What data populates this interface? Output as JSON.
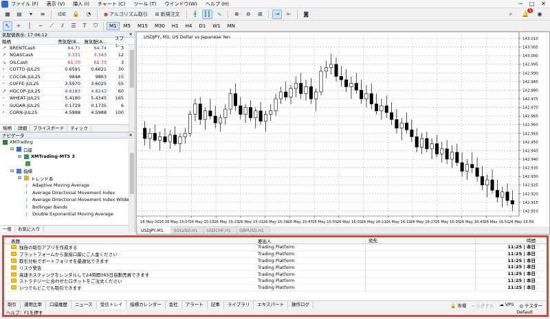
{
  "menu": {
    "items": [
      "ファイル (F)",
      "表示 (V)",
      "挿入 (I)",
      "チャート (C)",
      "ツール (T)",
      "ウインドウ(W)",
      "ヘルプ (H)"
    ]
  },
  "toolbar": {
    "ide_label": "IDE",
    "algo_label": "アルゴリズム取引",
    "new_order_label": "新規注文",
    "notif_count": "1"
  },
  "timeframes": [
    "M1",
    "M5",
    "M15",
    "M30",
    "H1",
    "H4",
    "D1",
    "W1",
    "MN"
  ],
  "market_watch": {
    "title": "気配値表示: 17:06:12",
    "columns": [
      "銘柄",
      "売気配(B...",
      "買気配(A...",
      "スプレ..."
    ],
    "rows": [
      {
        "dir": "up",
        "symbol": "BRENTCash",
        "bid": "64.71",
        "ask": "64.74",
        "spread": "3",
        "color": "blue"
      },
      {
        "dir": "up",
        "symbol": "NGASCash",
        "bid": "3.331",
        "ask": "3.343",
        "spread": "12",
        "color": "blue"
      },
      {
        "dir": "down",
        "symbol": "OILCash",
        "bid": "61.70",
        "ask": "61.73",
        "spread": "3",
        "color": "red"
      },
      {
        "dir": "none",
        "symbol": "COTTO-JUL25",
        "bid": "0.6591",
        "ask": "0.6621",
        "spread": "30",
        "color": "black"
      },
      {
        "dir": "none",
        "symbol": "COCOA-JUL25",
        "bid": "9848",
        "ask": "9863",
        "spread": "15",
        "color": "black"
      },
      {
        "dir": "none",
        "symbol": "COFFE-JUL25",
        "bid": "3.5970",
        "ask": "3.6025",
        "spread": "55",
        "color": "black"
      },
      {
        "dir": "up",
        "symbol": "HGCOP-JUL25",
        "bid": "4.8183",
        "ask": "4.8243",
        "spread": "60",
        "color": "blue"
      },
      {
        "dir": "none",
        "symbol": "WHEAT-JUL25",
        "bid": "5.4180",
        "ask": "5.4345",
        "spread": "165",
        "color": "black"
      },
      {
        "dir": "none",
        "symbol": "SUGAR-JUL25",
        "bid": "0.1729",
        "ask": "0.1735",
        "spread": "6",
        "color": "black"
      },
      {
        "dir": "none",
        "symbol": "CORN-JUL25",
        "bid": "4.5988",
        "ask": "4.5988",
        "spread": "100",
        "color": "black"
      }
    ],
    "tabs": [
      "銘柄",
      "詳細",
      "プライスボード",
      "ティック"
    ]
  },
  "navigator": {
    "title": "ナビゲータ",
    "items": [
      {
        "level": 0,
        "label": "XMTrading",
        "icon": "broker-icon"
      },
      {
        "level": 1,
        "label": "口座",
        "icon": "accounts-icon"
      },
      {
        "level": 2,
        "label": "XMTrading-MT5 3",
        "icon": "server-icon"
      },
      {
        "level": 3,
        "label": "",
        "icon": "user-icon"
      },
      {
        "level": 1,
        "label": "指標",
        "icon": "indicators-icon"
      },
      {
        "level": 2,
        "label": "トレンド系",
        "icon": "folder-icon"
      },
      {
        "level": 3,
        "label": "Adaptive Moving Average",
        "icon": "indicator-icon"
      },
      {
        "level": 3,
        "label": "Average Directional Movement Index",
        "icon": "indicator-icon"
      },
      {
        "level": 3,
        "label": "Average Directional Movement Index Wilder",
        "icon": "indicator-icon"
      },
      {
        "level": 3,
        "label": "Bollinger Bands",
        "icon": "indicator-icon"
      },
      {
        "level": 3,
        "label": "Double Exponential Moving Average",
        "icon": "indicator-icon"
      }
    ],
    "tabs": [
      "一般",
      "お気に入り"
    ]
  },
  "chart": {
    "title": "USDJPY, M1: US Dollar vs Japanese Yen",
    "tabs": [
      "USDJPY,M1",
      "SOLUSD,H1",
      "USDCHF,H1",
      "GBPUSD,H1"
    ],
    "colors": {
      "up": "#ffffff",
      "down": "#000000",
      "grid": "#b0b0b0"
    }
  },
  "chart_data": {
    "type": "candlestick",
    "y_ticks": [
      "143.010",
      "143.005",
      "143.000",
      "142.995",
      "142.990",
      "142.985",
      "142.980",
      "142.975",
      "142.970",
      "142.965",
      "142.960",
      "142.955",
      "142.950",
      "142.945",
      "142.940",
      "142.935",
      "142.930",
      "142.925",
      "142.920",
      "142.915",
      "142.910"
    ],
    "ylim": [
      142.907,
      143.012
    ],
    "x_ticks": [
      "26 May 2025",
      "26 May 15:07",
      "26 May 15:15",
      "26 May 15:23",
      "26 May 15:31",
      "26 May 15:39",
      "26 May 15:47",
      "26 May 15:55",
      "26 May 16:03",
      "26 May 16:11",
      "26 May 16:19",
      "26 May 16:27",
      "26 May 16:35",
      "26 May 16:43",
      "26 May 16:51",
      "26 May 16:59"
    ],
    "ohlc": [
      [
        142.958,
        142.962,
        142.948,
        142.952
      ],
      [
        142.952,
        142.958,
        142.946,
        142.955
      ],
      [
        142.955,
        142.96,
        142.95,
        142.951
      ],
      [
        142.951,
        142.956,
        142.945,
        142.953
      ],
      [
        142.953,
        142.958,
        142.949,
        142.95
      ],
      [
        142.95,
        142.957,
        142.946,
        142.954
      ],
      [
        142.954,
        142.959,
        142.948,
        142.949
      ],
      [
        142.949,
        142.955,
        142.944,
        142.953
      ],
      [
        142.953,
        142.958,
        142.949,
        142.955
      ],
      [
        142.955,
        142.968,
        142.953,
        142.966
      ],
      [
        142.966,
        142.975,
        142.962,
        142.972
      ],
      [
        142.972,
        142.976,
        142.96,
        142.963
      ],
      [
        142.963,
        142.97,
        142.957,
        142.968
      ],
      [
        142.968,
        142.975,
        142.963,
        142.965
      ],
      [
        142.965,
        142.971,
        142.958,
        142.961
      ],
      [
        142.961,
        142.966,
        142.956,
        142.964
      ],
      [
        142.964,
        142.972,
        142.96,
        142.969
      ],
      [
        142.969,
        142.981,
        142.966,
        142.978
      ],
      [
        142.978,
        142.984,
        142.968,
        142.971
      ],
      [
        142.971,
        142.976,
        142.963,
        142.966
      ],
      [
        142.966,
        142.972,
        142.961,
        142.97
      ],
      [
        142.97,
        142.974,
        142.962,
        142.964
      ],
      [
        142.964,
        142.97,
        142.958,
        142.968
      ],
      [
        142.968,
        142.973,
        142.96,
        142.962
      ],
      [
        142.962,
        142.968,
        142.956,
        142.966
      ],
      [
        142.966,
        142.972,
        142.962,
        142.968
      ],
      [
        142.968,
        142.978,
        142.965,
        142.975
      ],
      [
        142.975,
        142.982,
        142.972,
        142.979
      ],
      [
        142.979,
        142.985,
        142.974,
        142.976
      ],
      [
        142.976,
        142.983,
        142.972,
        142.981
      ],
      [
        142.981,
        142.988,
        142.976,
        142.984
      ],
      [
        142.984,
        142.99,
        142.975,
        142.978
      ],
      [
        142.978,
        142.986,
        142.974,
        142.982
      ],
      [
        142.982,
        142.987,
        142.972,
        142.975
      ],
      [
        142.975,
        142.981,
        142.968,
        142.979
      ],
      [
        142.979,
        142.994,
        142.977,
        142.991
      ],
      [
        142.991,
        142.997,
        142.987,
        142.993
      ],
      [
        142.993,
        143.001,
        142.989,
        142.995
      ],
      [
        142.995,
        142.999,
        142.985,
        142.988
      ],
      [
        142.988,
        142.994,
        142.982,
        142.986
      ],
      [
        142.986,
        142.992,
        142.979,
        142.982
      ],
      [
        142.982,
        142.988,
        142.975,
        142.984
      ],
      [
        142.984,
        142.99,
        142.978,
        142.98
      ],
      [
        142.98,
        142.986,
        142.972,
        142.975
      ],
      [
        142.975,
        142.983,
        142.97,
        142.978
      ],
      [
        142.978,
        142.984,
        142.969,
        142.972
      ],
      [
        142.972,
        142.978,
        142.966,
        142.968
      ],
      [
        142.968,
        142.975,
        142.963,
        142.971
      ],
      [
        142.971,
        142.977,
        142.964,
        142.967
      ],
      [
        142.967,
        142.973,
        142.96,
        142.963
      ],
      [
        142.963,
        142.969,
        142.955,
        142.958
      ],
      [
        142.958,
        142.964,
        142.951,
        142.961
      ],
      [
        142.961,
        142.967,
        142.955,
        142.957
      ],
      [
        142.957,
        142.963,
        142.95,
        142.953
      ],
      [
        142.953,
        142.958,
        142.944,
        142.947
      ],
      [
        142.947,
        142.955,
        142.943,
        142.952
      ],
      [
        142.952,
        142.956,
        142.944,
        142.946
      ],
      [
        142.946,
        142.952,
        142.94,
        142.949
      ],
      [
        142.949,
        142.954,
        142.941,
        142.943
      ],
      [
        142.943,
        142.95,
        142.938,
        142.946
      ],
      [
        142.946,
        142.951,
        142.937,
        142.94
      ],
      [
        142.94,
        142.948,
        142.935,
        142.944
      ],
      [
        142.944,
        142.949,
        142.936,
        142.938
      ],
      [
        142.938,
        142.944,
        142.93,
        142.933
      ],
      [
        142.933,
        142.94,
        142.928,
        142.937
      ],
      [
        142.937,
        142.944,
        142.932,
        142.935
      ],
      [
        142.935,
        142.941,
        142.927,
        142.93
      ],
      [
        142.93,
        142.936,
        142.922,
        142.925
      ],
      [
        142.925,
        142.931,
        142.918,
        142.928
      ],
      [
        142.928,
        142.934,
        142.92,
        142.922
      ],
      [
        142.922,
        142.928,
        142.915,
        142.918
      ],
      [
        142.918,
        142.924,
        142.912,
        142.921
      ],
      [
        142.921,
        142.926,
        142.913,
        142.916
      ],
      [
        142.916,
        142.922,
        142.91,
        142.914
      ]
    ]
  },
  "terminal": {
    "columns": [
      "表題",
      "差出人",
      "宛先",
      "時間"
    ],
    "rows": [
      {
        "subject": "独自の取引アプリを作成する",
        "from": "Trading Platform",
        "to": "",
        "time": "11:25 | 本日"
      },
      {
        "subject": "プラットフォームから直接口座にご入金ください",
        "from": "Trading Platform",
        "to": "",
        "time": "11:25 | 本日"
      },
      {
        "subject": "取引分析でポートフォリオを最適化できます",
        "from": "Trading Platform",
        "to": "",
        "time": "11:25 | 本日"
      },
      {
        "subject": "リスク警告",
        "from": "Trading Platform",
        "to": "",
        "time": "11:25 | 本日"
      },
      {
        "subject": "高速ホスティングをレンタルして24時間365日自動売買できます",
        "from": "Trading Platform",
        "to": "",
        "time": "11:25 | 本日"
      },
      {
        "subject": "ストラテジーに合わせたロボットをご注文ください",
        "from": "Trading Platform",
        "to": "",
        "time": "11:25 | 本日"
      },
      {
        "subject": "いつでもどこでも取引できます",
        "from": "Trading Platform",
        "to": "",
        "time": "11:25 | 本日"
      }
    ],
    "tabs": [
      "取引",
      "運用比率",
      "口座履歴",
      "ニュース",
      "受信トレイ",
      "指標カレンダー",
      "会社",
      "アラート",
      "記事",
      "ライブラリ",
      "エキスパート",
      "操作ログ"
    ],
    "selected_tab": "受信トレイ",
    "right_items": [
      "市場",
      "シグナル",
      "VPS",
      "テスター"
    ],
    "status_left": "ヘルプ：F1を押す",
    "status_right": "Default"
  }
}
